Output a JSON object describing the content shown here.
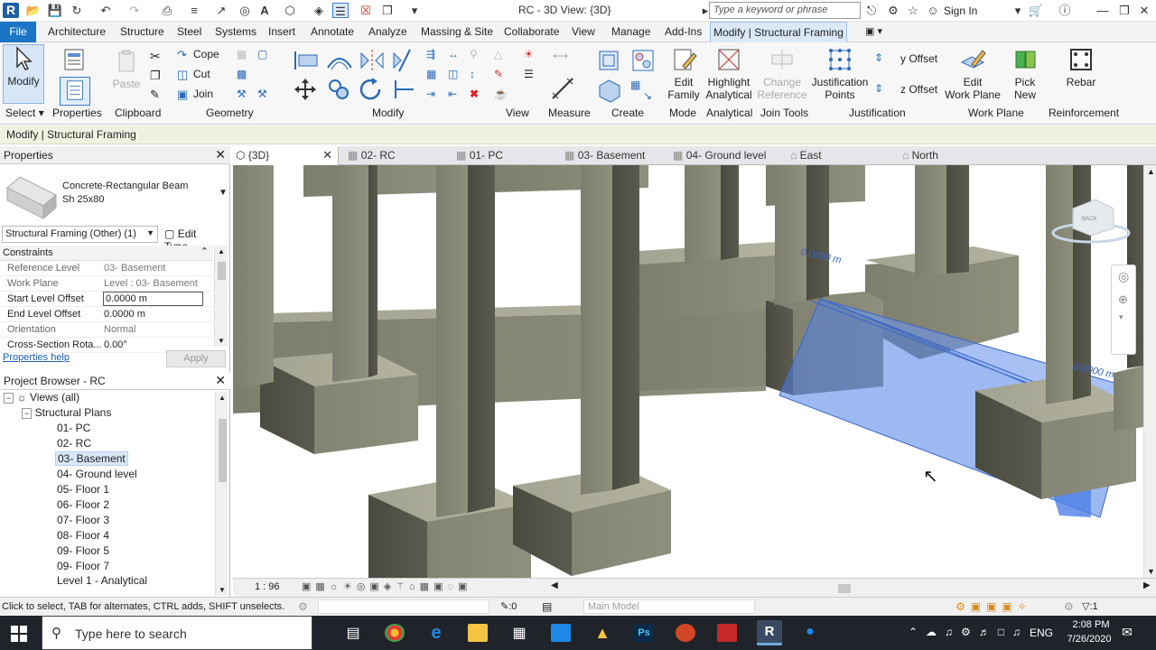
{
  "title_bar": {
    "title": "RC - 3D View: {3D}",
    "search_placeholder": "Type a keyword or phrase",
    "sign_in": "Sign In"
  },
  "menu_tabs": [
    "File",
    "Architecture",
    "Structure",
    "Steel",
    "Systems",
    "Insert",
    "Annotate",
    "Analyze",
    "Massing & Site",
    "Collaborate",
    "View",
    "Manage",
    "Add-Ins",
    "Modify | Structural Framing"
  ],
  "ribbon": {
    "modify": "Modify",
    "paste": "Paste",
    "cope": "Cope",
    "cut": "Cut",
    "join": "Join",
    "edit_family": [
      "Edit",
      "Family"
    ],
    "highlight_analytical": [
      "Highlight",
      "Analytical"
    ],
    "change_reference": [
      "Change",
      "Reference"
    ],
    "justification_points": [
      "Justification",
      "Points"
    ],
    "y_offset": "y Offset",
    "z_offset": "z Offset",
    "edit_work_plane": [
      "Edit",
      "Work Plane"
    ],
    "pick_new": [
      "Pick",
      "New"
    ],
    "rebar": "Rebar",
    "panel_labels": {
      "select": "Select",
      "properties": "Properties",
      "clipboard": "Clipboard",
      "geometry": "Geometry",
      "modify": "Modify",
      "view": "View",
      "measure": "Measure",
      "create": "Create",
      "mode": "Mode",
      "analytical": "Analytical",
      "join_tools": "Join Tools",
      "justification": "Justification",
      "work_plane": "Work Plane",
      "reinforcement": "Reinforcement"
    }
  },
  "context_bar": "Modify | Structural Framing",
  "properties": {
    "header": "Properties",
    "type_name": "Concrete-Rectangular Beam",
    "type_size": "Sh 25x80",
    "selector": "Structural Framing (Other) (1)",
    "edit_type": "Edit Type",
    "section": "Constraints",
    "rows": [
      {
        "k": "Reference Level",
        "v": "03- Basement"
      },
      {
        "k": "Work Plane",
        "v": "Level : 03- Basement"
      },
      {
        "k": "Start Level Offset",
        "v": "0.0000 m"
      },
      {
        "k": "End Level Offset",
        "v": "0.0000 m"
      },
      {
        "k": "Orientation",
        "v": "Normal"
      },
      {
        "k": "Cross-Section Rota...",
        "v": "0.00°"
      }
    ],
    "help_link": "Properties help",
    "apply": "Apply"
  },
  "project_browser": {
    "header": "Project Browser - RC",
    "items": [
      {
        "label": "Views (all)",
        "level": 0
      },
      {
        "label": "Structural Plans",
        "level": 1
      },
      {
        "label": "01- PC",
        "level": 2
      },
      {
        "label": "02- RC",
        "level": 2
      },
      {
        "label": "03- Basement",
        "level": 2,
        "selected": true
      },
      {
        "label": "04- Ground level",
        "level": 2
      },
      {
        "label": "05- Floor 1",
        "level": 2
      },
      {
        "label": "06- Floor 2",
        "level": 2
      },
      {
        "label": "07- Floor 3",
        "level": 2
      },
      {
        "label": "08- Floor 4",
        "level": 2
      },
      {
        "label": "09- Floor 5",
        "level": 2
      },
      {
        "label": "09- Floor 7",
        "level": 2
      },
      {
        "label": "Level 1 - Analytical",
        "level": 2
      }
    ]
  },
  "view_tabs": [
    "{3D}",
    "02- RC",
    "01- PC",
    "03- Basement",
    "04- Ground level",
    "East",
    "North"
  ],
  "viewport": {
    "dim1": "0.0000 m",
    "dim2": "0.0000 m",
    "viewcube_label": "BACK"
  },
  "view_controls": {
    "scale": "1 : 96"
  },
  "status": {
    "hint": "Click to select, TAB for alternates, CTRL adds, SHIFT unselects.",
    "zero": ":0",
    "model": "Main Model",
    "filter": ":1"
  },
  "taskbar": {
    "search": "Type here to search",
    "lang": "ENG",
    "time": "2:08 PM",
    "date": "7/26/2020"
  },
  "colors": {
    "accent": "#1c74c6",
    "selection": "#4d7fe6",
    "concrete": "#8c8c7a"
  }
}
